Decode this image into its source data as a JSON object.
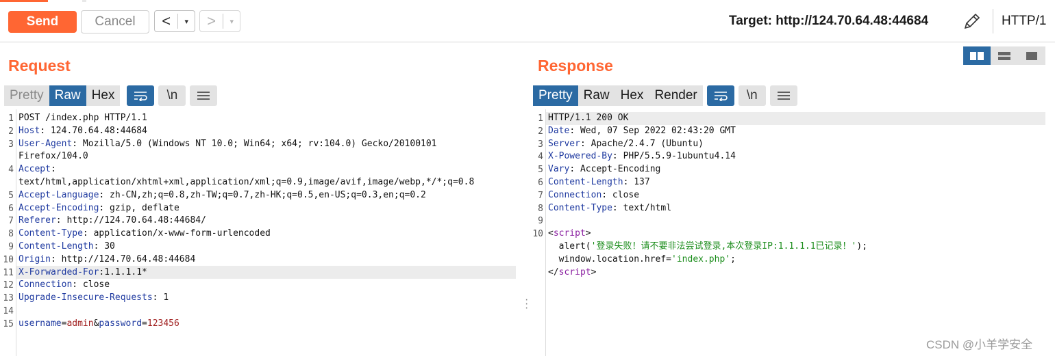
{
  "toolbar": {
    "send_label": "Send",
    "cancel_label": "Cancel",
    "back_icon": "‹",
    "forward_icon": "›",
    "dropdown_icon": "▾",
    "target_text": "Target: http://124.70.64.48:44684",
    "protocol_label": "HTTP/1"
  },
  "request": {
    "title": "Request",
    "tabs": [
      "Pretty",
      "Raw",
      "Hex"
    ],
    "active_tab": "Raw",
    "wrap_icon": "wrap-icon",
    "newline_label": "\\n",
    "menu_icon": "hamburger-icon",
    "lines": [
      {
        "n": "1",
        "h": "POST /index.php HTTP/1.1",
        "v": ""
      },
      {
        "n": "2",
        "h": "Host",
        "v": ": 124.70.64.48:44684"
      },
      {
        "n": "3",
        "h": "User-Agent",
        "v": ": Mozilla/5.0 (Windows NT 10.0; Win64; x64; rv:104.0) Gecko/20100101"
      },
      {
        "n": "",
        "h": "",
        "v": "Firefox/104.0"
      },
      {
        "n": "4",
        "h": "Accept",
        "v": ":"
      },
      {
        "n": "",
        "h": "",
        "v": "text/html,application/xhtml+xml,application/xml;q=0.9,image/avif,image/webp,*/*;q=0.8"
      },
      {
        "n": "5",
        "h": "Accept-Language",
        "v": ": zh-CN,zh;q=0.8,zh-TW;q=0.7,zh-HK;q=0.5,en-US;q=0.3,en;q=0.2"
      },
      {
        "n": "6",
        "h": "Accept-Encoding",
        "v": ": gzip, deflate"
      },
      {
        "n": "7",
        "h": "Referer",
        "v": ": http://124.70.64.48:44684/"
      },
      {
        "n": "8",
        "h": "Content-Type",
        "v": ": application/x-www-form-urlencoded"
      },
      {
        "n": "9",
        "h": "Content-Length",
        "v": ": 30"
      },
      {
        "n": "10",
        "h": "Origin",
        "v": ": http://124.70.64.48:44684"
      },
      {
        "n": "11",
        "h": "X-Forwarded-For",
        "v": ":1.1.1.1*"
      },
      {
        "n": "12",
        "h": "Connection",
        "v": ": close"
      },
      {
        "n": "13",
        "h": "Upgrade-Insecure-Requests",
        "v": ": 1"
      },
      {
        "n": "14",
        "h": "",
        "v": ""
      },
      {
        "n": "15",
        "h": "",
        "v": ""
      }
    ],
    "body_param_1_name": "username",
    "body_param_1_value": "admin",
    "body_param_2_name": "password",
    "body_param_2_value": "123456"
  },
  "response": {
    "title": "Response",
    "tabs": [
      "Pretty",
      "Raw",
      "Hex",
      "Render"
    ],
    "active_tab": "Pretty",
    "newline_label": "\\n",
    "lines": [
      {
        "n": "1",
        "h": "HTTP/1.1 200 OK",
        "v": ""
      },
      {
        "n": "2",
        "h": "Date",
        "v": ": Wed, 07 Sep 2022 02:43:20 GMT"
      },
      {
        "n": "3",
        "h": "Server",
        "v": ": Apache/2.4.7 (Ubuntu)"
      },
      {
        "n": "4",
        "h": "X-Powered-By",
        "v": ": PHP/5.5.9-1ubuntu4.14"
      },
      {
        "n": "5",
        "h": "Vary",
        "v": ": Accept-Encoding"
      },
      {
        "n": "6",
        "h": "Content-Length",
        "v": ": 137"
      },
      {
        "n": "7",
        "h": "Connection",
        "v": ": close"
      },
      {
        "n": "8",
        "h": "Content-Type",
        "v": ": text/html"
      },
      {
        "n": "9",
        "h": "",
        "v": ""
      },
      {
        "n": "10",
        "h": "",
        "v": ""
      }
    ],
    "script_open_lt": "<",
    "script_tag": "script",
    "script_open_gt": ">",
    "alert_prefix": "  alert(",
    "alert_string": "'登录失败！请不要非法尝试登录,本次登录IP:1.1.1.1已记录！'",
    "alert_suffix": ");",
    "location_prefix": "  window.location.href=",
    "location_string": "'index.php'",
    "location_suffix": ";",
    "script_close_lt": "</",
    "script_close_gt": ">"
  },
  "watermark": "CSDN @小羊学安全",
  "colors": {
    "accent": "#ff6633",
    "active_tab": "#2b6aa3",
    "header_name": "#1f3aa0"
  }
}
